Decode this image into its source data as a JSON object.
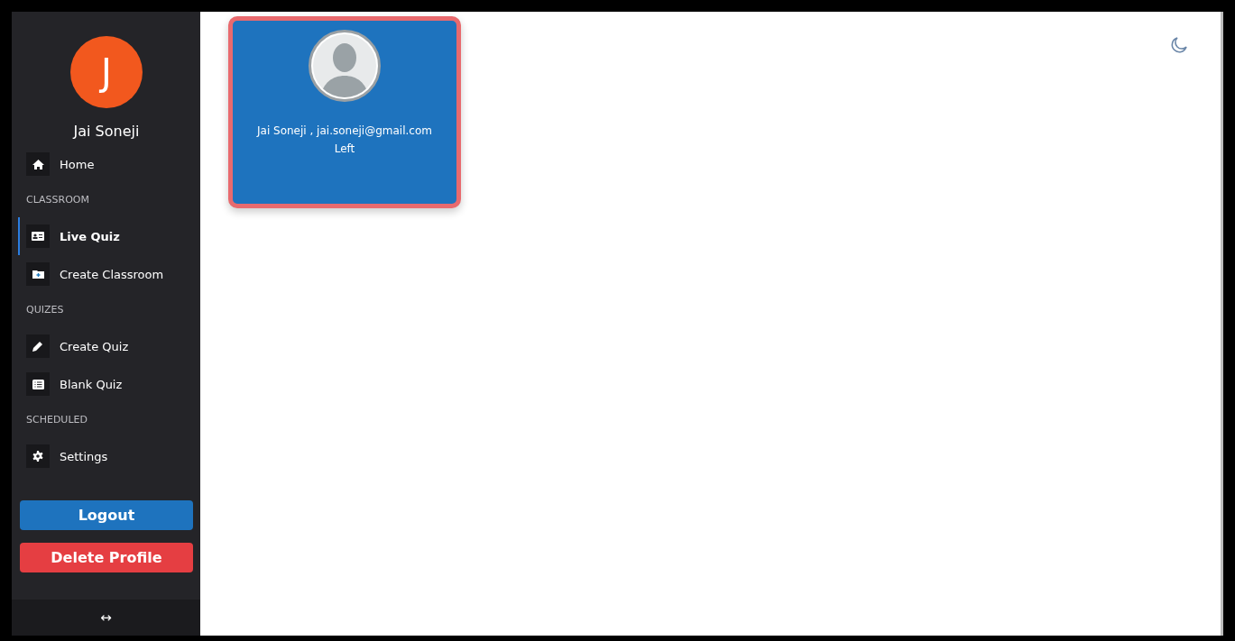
{
  "profile": {
    "initial": "J",
    "name": "Jai Soneji"
  },
  "nav": [
    {
      "kind": "item",
      "label": "Home",
      "selected": false
    },
    {
      "kind": "header",
      "label": "CLASSROOM"
    },
    {
      "kind": "item",
      "label": "Live Quiz",
      "selected": true
    },
    {
      "kind": "item",
      "label": "Create Classroom",
      "selected": false
    },
    {
      "kind": "header",
      "label": "QUIZES"
    },
    {
      "kind": "item",
      "label": "Create Quiz",
      "selected": false
    },
    {
      "kind": "item",
      "label": "Blank Quiz",
      "selected": false
    },
    {
      "kind": "header",
      "label": "SCHEDULED"
    },
    {
      "kind": "item",
      "label": "Settings",
      "selected": false
    }
  ],
  "buttons": [
    {
      "kind": "primary",
      "label": "Logout"
    },
    {
      "kind": "danger",
      "label": "Delete Profile"
    }
  ],
  "collapse_toggle": "↔",
  "participants": [
    {
      "line": "Jai Soneji , jai.soneji@gmail.com",
      "status": "Left"
    }
  ]
}
